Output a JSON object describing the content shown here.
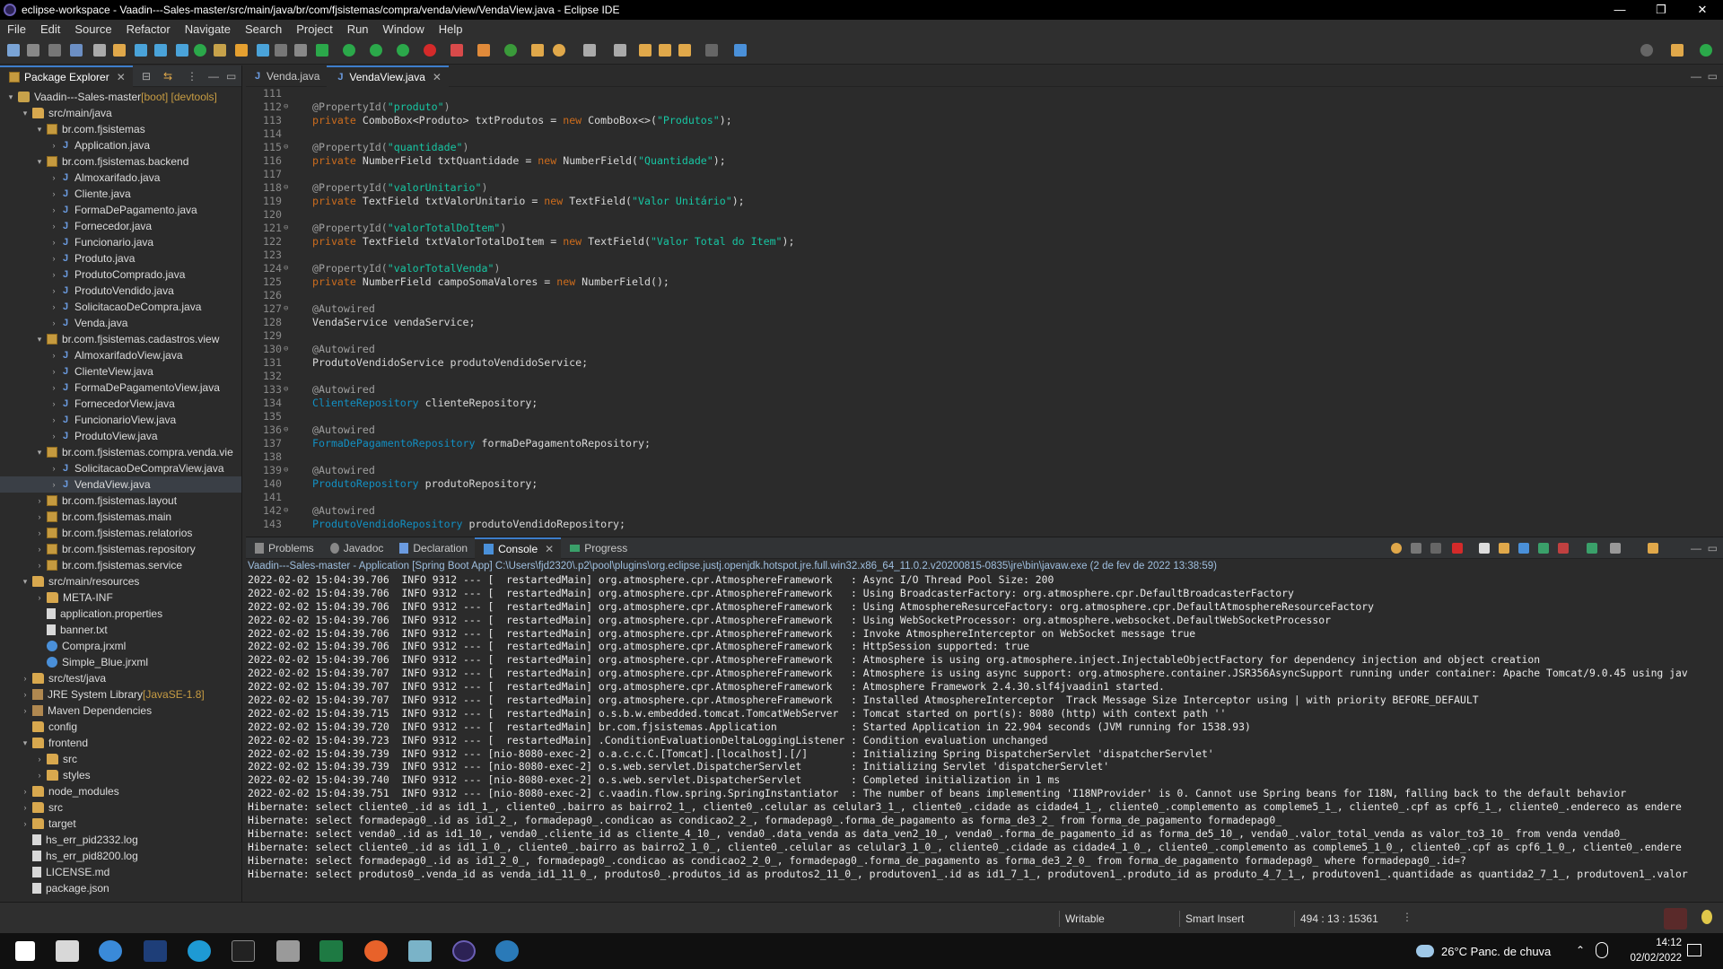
{
  "window": {
    "title": "eclipse-workspace - Vaadin---Sales-master/src/main/java/br/com/fjsistemas/compra/venda/view/VendaView.java - Eclipse IDE",
    "controls": [
      "—",
      "❐",
      "✕"
    ]
  },
  "menu": [
    "File",
    "Edit",
    "Source",
    "Refactor",
    "Navigate",
    "Search",
    "Project",
    "Run",
    "Window",
    "Help"
  ],
  "package_explorer": {
    "tab_label": "Package Explorer",
    "items": [
      {
        "text": "Vaadin---Sales-master",
        "deco": " [boot] [devtools]",
        "icon": "project-icon",
        "indent": 0,
        "tw": "▾"
      },
      {
        "text": "src/main/java",
        "icon": "folder-icon",
        "indent": 1,
        "tw": "▾"
      },
      {
        "text": "br.com.fjsistemas",
        "icon": "package-icon",
        "indent": 2,
        "tw": "▾"
      },
      {
        "text": "Application.java",
        "icon": "java-file-icon",
        "indent": 3,
        "tw": "›"
      },
      {
        "text": "br.com.fjsistemas.backend",
        "icon": "package-icon",
        "indent": 2,
        "tw": "▾"
      },
      {
        "text": "Almoxarifado.java",
        "icon": "java-file-icon",
        "indent": 3,
        "tw": "›"
      },
      {
        "text": "Cliente.java",
        "icon": "java-file-icon",
        "indent": 3,
        "tw": "›"
      },
      {
        "text": "FormaDePagamento.java",
        "icon": "java-file-icon",
        "indent": 3,
        "tw": "›"
      },
      {
        "text": "Fornecedor.java",
        "icon": "java-file-icon",
        "indent": 3,
        "tw": "›"
      },
      {
        "text": "Funcionario.java",
        "icon": "java-file-icon",
        "indent": 3,
        "tw": "›"
      },
      {
        "text": "Produto.java",
        "icon": "java-file-icon",
        "indent": 3,
        "tw": "›"
      },
      {
        "text": "ProdutoComprado.java",
        "icon": "java-file-icon",
        "indent": 3,
        "tw": "›"
      },
      {
        "text": "ProdutoVendido.java",
        "icon": "java-file-icon",
        "indent": 3,
        "tw": "›"
      },
      {
        "text": "SolicitacaoDeCompra.java",
        "icon": "java-file-icon",
        "indent": 3,
        "tw": "›"
      },
      {
        "text": "Venda.java",
        "icon": "java-file-icon",
        "indent": 3,
        "tw": "›"
      },
      {
        "text": "br.com.fjsistemas.cadastros.view",
        "icon": "package-icon",
        "indent": 2,
        "tw": "▾"
      },
      {
        "text": "AlmoxarifadoView.java",
        "icon": "java-file-icon",
        "indent": 3,
        "tw": "›"
      },
      {
        "text": "ClienteView.java",
        "icon": "java-file-icon",
        "indent": 3,
        "tw": "›"
      },
      {
        "text": "FormaDePagamentoView.java",
        "icon": "java-file-icon",
        "indent": 3,
        "tw": "›"
      },
      {
        "text": "FornecedorView.java",
        "icon": "java-file-icon",
        "indent": 3,
        "tw": "›"
      },
      {
        "text": "FuncionarioView.java",
        "icon": "java-file-icon",
        "indent": 3,
        "tw": "›"
      },
      {
        "text": "ProdutoView.java",
        "icon": "java-file-icon",
        "indent": 3,
        "tw": "›"
      },
      {
        "text": "br.com.fjsistemas.compra.venda.vie",
        "icon": "package-icon",
        "indent": 2,
        "tw": "▾"
      },
      {
        "text": "SolicitacaoDeCompraView.java",
        "icon": "java-file-icon",
        "indent": 3,
        "tw": "›"
      },
      {
        "text": "VendaView.java",
        "icon": "java-file-icon",
        "indent": 3,
        "tw": "›",
        "selected": true
      },
      {
        "text": "br.com.fjsistemas.layout",
        "icon": "package-icon",
        "indent": 2,
        "tw": "›"
      },
      {
        "text": "br.com.fjsistemas.main",
        "icon": "package-icon",
        "indent": 2,
        "tw": "›"
      },
      {
        "text": "br.com.fjsistemas.relatorios",
        "icon": "package-icon",
        "indent": 2,
        "tw": "›"
      },
      {
        "text": "br.com.fjsistemas.repository",
        "icon": "package-icon",
        "indent": 2,
        "tw": "›"
      },
      {
        "text": "br.com.fjsistemas.service",
        "icon": "package-icon",
        "indent": 2,
        "tw": "›"
      },
      {
        "text": "src/main/resources",
        "icon": "folder-icon",
        "indent": 1,
        "tw": "▾"
      },
      {
        "text": "META-INF",
        "icon": "folder-icon",
        "indent": 2,
        "tw": "›"
      },
      {
        "text": "application.properties",
        "icon": "file-icon",
        "indent": 2,
        "tw": ""
      },
      {
        "text": "banner.txt",
        "icon": "file-icon",
        "indent": 2,
        "tw": ""
      },
      {
        "text": "Compra.jrxml",
        "icon": "jrxml-icon",
        "indent": 2,
        "tw": ""
      },
      {
        "text": "Simple_Blue.jrxml",
        "icon": "jrxml-icon",
        "indent": 2,
        "tw": ""
      },
      {
        "text": "src/test/java",
        "icon": "folder-icon",
        "indent": 1,
        "tw": "›"
      },
      {
        "text": "JRE System Library",
        "deco": " [JavaSE-1.8]",
        "icon": "library-icon",
        "indent": 1,
        "tw": "›"
      },
      {
        "text": "Maven Dependencies",
        "icon": "library-icon",
        "indent": 1,
        "tw": "›"
      },
      {
        "text": "config",
        "icon": "folder-icon",
        "indent": 1,
        "tw": ""
      },
      {
        "text": "frontend",
        "icon": "folder-icon",
        "indent": 1,
        "tw": "▾"
      },
      {
        "text": "src",
        "icon": "folder-icon",
        "indent": 2,
        "tw": "›"
      },
      {
        "text": "styles",
        "icon": "folder-icon",
        "indent": 2,
        "tw": "›"
      },
      {
        "text": "node_modules",
        "icon": "folder-icon",
        "indent": 1,
        "tw": "›"
      },
      {
        "text": "src",
        "icon": "folder-icon",
        "indent": 1,
        "tw": "›"
      },
      {
        "text": "target",
        "icon": "folder-icon",
        "indent": 1,
        "tw": "›"
      },
      {
        "text": "hs_err_pid2332.log",
        "icon": "file-icon",
        "indent": 1,
        "tw": ""
      },
      {
        "text": "hs_err_pid8200.log",
        "icon": "file-icon",
        "indent": 1,
        "tw": ""
      },
      {
        "text": "LICENSE.md",
        "icon": "file-icon",
        "indent": 1,
        "tw": ""
      },
      {
        "text": "package.json",
        "icon": "file-icon",
        "indent": 1,
        "tw": ""
      }
    ]
  },
  "editor": {
    "tabs": [
      {
        "label": "Venda.java",
        "active": false
      },
      {
        "label": "VendaView.java",
        "active": true
      }
    ],
    "lines": [
      {
        "n": "111",
        "fold": "",
        "html": ""
      },
      {
        "n": "112",
        "fold": "⊖",
        "html": "<span class='ann'>@PropertyId(</span><span class='str'>\"produto\"</span><span class='ann'>)</span>"
      },
      {
        "n": "113",
        "fold": "",
        "html": "<span class='kw'>private</span> ComboBox&lt;Produto&gt; txtProdutos = <span class='kw'>new</span> ComboBox&lt;&gt;(<span class='str'>\"Produtos\"</span>);"
      },
      {
        "n": "114",
        "fold": "",
        "html": ""
      },
      {
        "n": "115",
        "fold": "⊖",
        "html": "<span class='ann'>@PropertyId(</span><span class='str'>\"quantidade\"</span><span class='ann'>)</span>"
      },
      {
        "n": "116",
        "fold": "",
        "html": "<span class='kw'>private</span> NumberField txtQuantidade = <span class='kw'>new</span> NumberField(<span class='str'>\"Quantidade\"</span>);"
      },
      {
        "n": "117",
        "fold": "",
        "html": ""
      },
      {
        "n": "118",
        "fold": "⊖",
        "html": "<span class='ann'>@PropertyId(</span><span class='str'>\"valorUnitario\"</span><span class='ann'>)</span>"
      },
      {
        "n": "119",
        "fold": "",
        "html": "<span class='kw'>private</span> TextField txtValorUnitario = <span class='kw'>new</span> TextField(<span class='str'>\"Valor Unitário\"</span>);"
      },
      {
        "n": "120",
        "fold": "",
        "html": ""
      },
      {
        "n": "121",
        "fold": "⊖",
        "html": "<span class='ann'>@PropertyId(</span><span class='str'>\"valorTotalDoItem\"</span><span class='ann'>)</span>"
      },
      {
        "n": "122",
        "fold": "",
        "html": "<span class='kw'>private</span> TextField txtValorTotalDoItem = <span class='kw'>new</span> TextField(<span class='str'>\"Valor Total do Item\"</span>);"
      },
      {
        "n": "123",
        "fold": "",
        "html": ""
      },
      {
        "n": "124",
        "fold": "⊖",
        "html": "<span class='ann'>@PropertyId(</span><span class='str'>\"valorTotalVenda\"</span><span class='ann'>)</span>"
      },
      {
        "n": "125",
        "fold": "",
        "html": "<span class='kw'>private</span> NumberField campoSomaValores = <span class='kw'>new</span> NumberField();"
      },
      {
        "n": "126",
        "fold": "",
        "html": ""
      },
      {
        "n": "127",
        "fold": "⊖",
        "html": "<span class='ann'>@Autowired</span>"
      },
      {
        "n": "128",
        "fold": "",
        "html": "VendaService vendaService;"
      },
      {
        "n": "129",
        "fold": "",
        "html": ""
      },
      {
        "n": "130",
        "fold": "⊖",
        "html": "<span class='ann'>@Autowired</span>"
      },
      {
        "n": "131",
        "fold": "",
        "html": "ProdutoVendidoService produtoVendidoService;"
      },
      {
        "n": "132",
        "fold": "",
        "html": ""
      },
      {
        "n": "133",
        "fold": "⊖",
        "html": "<span class='ann'>@Autowired</span>"
      },
      {
        "n": "134",
        "fold": "",
        "html": "<span class='ty'>ClienteRepository</span> clienteRepository;"
      },
      {
        "n": "135",
        "fold": "",
        "html": ""
      },
      {
        "n": "136",
        "fold": "⊖",
        "html": "<span class='ann'>@Autowired</span>"
      },
      {
        "n": "137",
        "fold": "",
        "html": "<span class='ty'>FormaDePagamentoRepository</span> formaDePagamentoRepository;"
      },
      {
        "n": "138",
        "fold": "",
        "html": ""
      },
      {
        "n": "139",
        "fold": "⊖",
        "html": "<span class='ann'>@Autowired</span>"
      },
      {
        "n": "140",
        "fold": "",
        "html": "<span class='ty'>ProdutoRepository</span> produtoRepository;"
      },
      {
        "n": "141",
        "fold": "",
        "html": ""
      },
      {
        "n": "142",
        "fold": "⊖",
        "html": "<span class='ann'>@Autowired</span>"
      },
      {
        "n": "143",
        "fold": "",
        "html": "<span class='ty'>ProdutoVendidoRepository</span> produtoVendidoRepository;"
      }
    ]
  },
  "console": {
    "tabs": [
      {
        "label": "Problems",
        "icon": "problems-icon"
      },
      {
        "label": "Javadoc",
        "icon": "javadoc-icon"
      },
      {
        "label": "Declaration",
        "icon": "declaration-icon"
      },
      {
        "label": "Console",
        "icon": "console-icon",
        "active": true
      },
      {
        "label": "Progress",
        "icon": "progress-icon"
      }
    ],
    "header": "Vaadin---Sales-master - Application [Spring Boot App] C:\\Users\\fjd2320\\.p2\\pool\\plugins\\org.eclipse.justj.openjdk.hotspot.jre.full.win32.x86_64_11.0.2.v20200815-0835\\jre\\bin\\javaw.exe  (2 de fev de 2022 13:38:59)",
    "lines": [
      "2022-02-02 15:04:39.706  INFO 9312 --- [  restartedMain] org.atmosphere.cpr.AtmosphereFramework   : Async I/O Thread Pool Size: 200",
      "2022-02-02 15:04:39.706  INFO 9312 --- [  restartedMain] org.atmosphere.cpr.AtmosphereFramework   : Using BroadcasterFactory: org.atmosphere.cpr.DefaultBroadcasterFactory",
      "2022-02-02 15:04:39.706  INFO 9312 --- [  restartedMain] org.atmosphere.cpr.AtmosphereFramework   : Using AtmosphereResurceFactory: org.atmosphere.cpr.DefaultAtmosphereResourceFactory",
      "2022-02-02 15:04:39.706  INFO 9312 --- [  restartedMain] org.atmosphere.cpr.AtmosphereFramework   : Using WebSocketProcessor: org.atmosphere.websocket.DefaultWebSocketProcessor",
      "2022-02-02 15:04:39.706  INFO 9312 --- [  restartedMain] org.atmosphere.cpr.AtmosphereFramework   : Invoke AtmosphereInterceptor on WebSocket message true",
      "2022-02-02 15:04:39.706  INFO 9312 --- [  restartedMain] org.atmosphere.cpr.AtmosphereFramework   : HttpSession supported: true",
      "2022-02-02 15:04:39.706  INFO 9312 --- [  restartedMain] org.atmosphere.cpr.AtmosphereFramework   : Atmosphere is using org.atmosphere.inject.InjectableObjectFactory for dependency injection and object creation",
      "2022-02-02 15:04:39.707  INFO 9312 --- [  restartedMain] org.atmosphere.cpr.AtmosphereFramework   : Atmosphere is using async support: org.atmosphere.container.JSR356AsyncSupport running under container: Apache Tomcat/9.0.45 using jav",
      "2022-02-02 15:04:39.707  INFO 9312 --- [  restartedMain] org.atmosphere.cpr.AtmosphereFramework   : Atmosphere Framework 2.4.30.slf4jvaadin1 started.",
      "2022-02-02 15:04:39.707  INFO 9312 --- [  restartedMain] org.atmosphere.cpr.AtmosphereFramework   : Installed AtmosphereInterceptor  Track Message Size Interceptor using | with priority BEFORE_DEFAULT",
      "2022-02-02 15:04:39.715  INFO 9312 --- [  restartedMain] o.s.b.w.embedded.tomcat.TomcatWebServer  : Tomcat started on port(s): 8080 (http) with context path ''",
      "2022-02-02 15:04:39.720  INFO 9312 --- [  restartedMain] br.com.fjsistemas.Application            : Started Application in 22.904 seconds (JVM running for 1538.93)",
      "2022-02-02 15:04:39.723  INFO 9312 --- [  restartedMain] .ConditionEvaluationDeltaLoggingListener : Condition evaluation unchanged",
      "2022-02-02 15:04:39.739  INFO 9312 --- [nio-8080-exec-2] o.a.c.c.C.[Tomcat].[localhost].[/]       : Initializing Spring DispatcherServlet 'dispatcherServlet'",
      "2022-02-02 15:04:39.739  INFO 9312 --- [nio-8080-exec-2] o.s.web.servlet.DispatcherServlet        : Initializing Servlet 'dispatcherServlet'",
      "2022-02-02 15:04:39.740  INFO 9312 --- [nio-8080-exec-2] o.s.web.servlet.DispatcherServlet        : Completed initialization in 1 ms",
      "2022-02-02 15:04:39.751  INFO 9312 --- [nio-8080-exec-2] c.vaadin.flow.spring.SpringInstantiator  : The number of beans implementing 'I18NProvider' is 0. Cannot use Spring beans for I18N, falling back to the default behavior",
      "Hibernate: select cliente0_.id as id1_1_, cliente0_.bairro as bairro2_1_, cliente0_.celular as celular3_1_, cliente0_.cidade as cidade4_1_, cliente0_.complemento as compleme5_1_, cliente0_.cpf as cpf6_1_, cliente0_.endereco as endere",
      "Hibernate: select formadepag0_.id as id1_2_, formadepag0_.condicao as condicao2_2_, formadepag0_.forma_de_pagamento as forma_de3_2_ from forma_de_pagamento formadepag0_",
      "Hibernate: select venda0_.id as id1_10_, venda0_.cliente_id as cliente_4_10_, venda0_.data_venda as data_ven2_10_, venda0_.forma_de_pagamento_id as forma_de5_10_, venda0_.valor_total_venda as valor_to3_10_ from venda venda0_",
      "Hibernate: select cliente0_.id as id1_1_0_, cliente0_.bairro as bairro2_1_0_, cliente0_.celular as celular3_1_0_, cliente0_.cidade as cidade4_1_0_, cliente0_.complemento as compleme5_1_0_, cliente0_.cpf as cpf6_1_0_, cliente0_.endere",
      "Hibernate: select formadepag0_.id as id1_2_0_, formadepag0_.condicao as condicao2_2_0_, formadepag0_.forma_de_pagamento as forma_de3_2_0_ from forma_de_pagamento formadepag0_ where formadepag0_.id=?",
      "Hibernate: select produtos0_.venda_id as venda_id1_11_0_, produtos0_.produtos_id as produtos2_11_0_, produtoven1_.id as id1_7_1_, produtoven1_.produto_id as produto_4_7_1_, produtoven1_.quantidade as quantida2_7_1_, produtoven1_.valor"
    ]
  },
  "status": {
    "writable": "Writable",
    "insert_mode": "Smart Insert",
    "position": "494 : 13 : 15361"
  },
  "taskbar": {
    "weather": "26°C  Panc. de chuva",
    "time": "14:12",
    "date": "02/02/2022"
  }
}
